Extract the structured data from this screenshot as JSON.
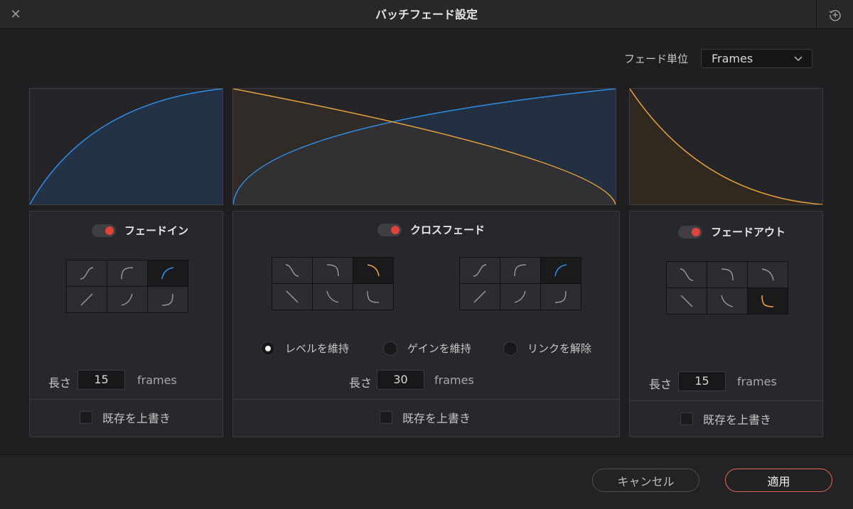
{
  "window": {
    "title": "バッチフェード設定",
    "close_icon": "close-icon",
    "reset_icon": "reset-icon"
  },
  "fade_unit": {
    "label": "フェード単位",
    "selected": "Frames"
  },
  "colors": {
    "accent_blue": "#2f8fe6",
    "accent_orange": "#e8a33c",
    "toggle_on": "#e0433a",
    "apply_border": "#e06a55"
  },
  "fade_in": {
    "enabled": true,
    "label": "フェードイン",
    "length_label": "長さ",
    "length_value": "15",
    "length_unit": "frames",
    "overwrite_label": "既存を上書き",
    "overwrite_checked": false,
    "curves": [
      "s-curve-up",
      "ease-in-up",
      "log-up",
      "linear-up",
      "exp-up",
      "exp-sharp-up"
    ],
    "selected_curve": 2
  },
  "crossfade": {
    "enabled": true,
    "label": "クロスフェード",
    "out_curves": [
      "s-curve-down",
      "ease-down",
      "log-down",
      "linear-down",
      "exp-down",
      "exp-sharp-down"
    ],
    "out_selected": 2,
    "in_curves": [
      "s-curve-up",
      "ease-in-up",
      "log-up",
      "linear-up",
      "exp-up",
      "exp-sharp-up"
    ],
    "in_selected": 2,
    "modes": [
      {
        "label": "レベルを維持",
        "selected": true
      },
      {
        "label": "ゲインを維持",
        "selected": false
      },
      {
        "label": "リンクを解除",
        "selected": false
      }
    ],
    "length_label": "長さ",
    "length_value": "30",
    "length_unit": "frames",
    "overwrite_label": "既存を上書き",
    "overwrite_checked": false
  },
  "fade_out": {
    "enabled": true,
    "label": "フェードアウト",
    "length_label": "長さ",
    "length_value": "15",
    "length_unit": "frames",
    "overwrite_label": "既存を上書き",
    "overwrite_checked": false,
    "curves": [
      "s-curve-down",
      "ease-down",
      "log-down",
      "linear-down",
      "exp-down",
      "exp-sharp-down"
    ],
    "selected_curve": 5
  },
  "buttons": {
    "cancel": "キャンセル",
    "apply": "適用"
  }
}
